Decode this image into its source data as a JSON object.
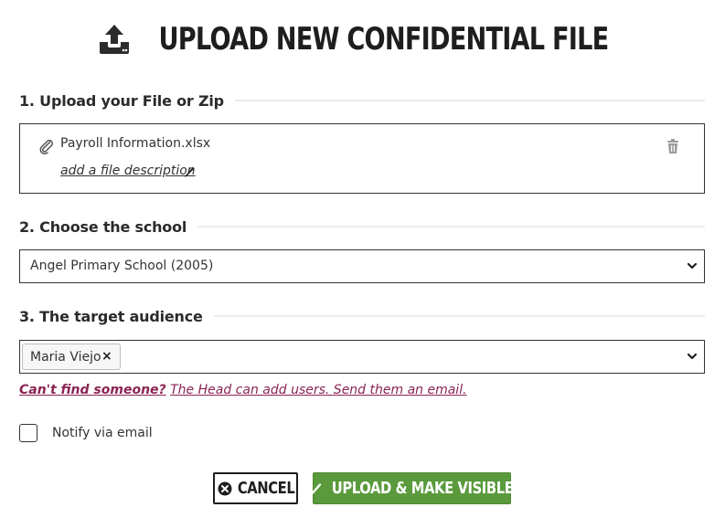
{
  "title": "UPLOAD NEW CONFIDENTIAL FILE",
  "sections": {
    "upload": {
      "label": "1. Upload your File or Zip"
    },
    "school": {
      "label": "2. Choose the school"
    },
    "audience": {
      "label": "3. The target audience"
    }
  },
  "file": {
    "name": "Payroll Information.xlsx",
    "description_link": "add a file description"
  },
  "school_select": {
    "value": "Angel Primary School (2005)"
  },
  "audience_select": {
    "tags": [
      {
        "label": "Maria Viejo",
        "remove": "×"
      }
    ]
  },
  "help": {
    "strong": "Can't find someone?",
    "rest": "The Head can add users. Send them an email."
  },
  "notify": {
    "label": "Notify via email",
    "checked": false
  },
  "buttons": {
    "cancel": "CANCEL",
    "upload": "UPLOAD & MAKE VISIBLE"
  },
  "colors": {
    "primary_button": "#5a9a3c",
    "help_link": "#8a2353",
    "border": "#333333"
  },
  "icons": {
    "title": "upload-icon",
    "attachment": "paperclip-icon",
    "edit": "pencil-icon",
    "delete": "trash-icon",
    "dropdown": "chevron-down-icon",
    "cancel": "close-circle-icon",
    "confirm": "checkmark-icon"
  }
}
